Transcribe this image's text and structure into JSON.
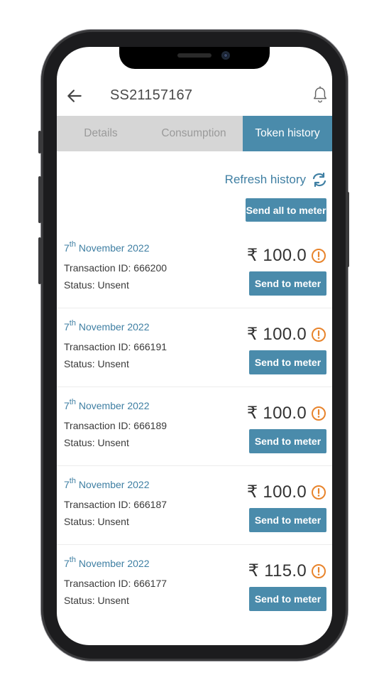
{
  "header": {
    "title": "SS21157167"
  },
  "tabs": [
    {
      "label": "Details"
    },
    {
      "label": "Consumption"
    },
    {
      "label": "Token history"
    }
  ],
  "actions": {
    "refresh_label": "Refresh history",
    "send_all_label": "Send all to meter"
  },
  "transactions": [
    {
      "day": "7",
      "day_suffix": "th",
      "month_year": "November 2022",
      "transaction_id": "Transaction ID: 666200",
      "status": "Status: Unsent",
      "amount": "₹ 100.0",
      "send_label": "Send to meter"
    },
    {
      "day": "7",
      "day_suffix": "th",
      "month_year": "November 2022",
      "transaction_id": "Transaction ID: 666191",
      "status": "Status: Unsent",
      "amount": "₹ 100.0",
      "send_label": "Send to meter"
    },
    {
      "day": "7",
      "day_suffix": "th",
      "month_year": "November 2022",
      "transaction_id": "Transaction ID: 666189",
      "status": "Status: Unsent",
      "amount": "₹ 100.0",
      "send_label": "Send to meter"
    },
    {
      "day": "7",
      "day_suffix": "th",
      "month_year": "November 2022",
      "transaction_id": "Transaction ID: 666187",
      "status": "Status: Unsent",
      "amount": "₹ 100.0",
      "send_label": "Send to meter"
    },
    {
      "day": "7",
      "day_suffix": "th",
      "month_year": "November 2022",
      "transaction_id": "Transaction ID: 666177",
      "status": "Status: Unsent",
      "amount": "₹ 115.0",
      "send_label": "Send to meter"
    }
  ],
  "icons": {
    "back": "arrow-left-icon",
    "notification": "bell-icon",
    "refresh": "refresh-icon",
    "warning": "warning-circle-icon"
  },
  "colors": {
    "accent": "#4a8bab",
    "link": "#3f7fa3",
    "warning": "#e8842c",
    "tab_inactive_bg": "#d6d6d6"
  }
}
